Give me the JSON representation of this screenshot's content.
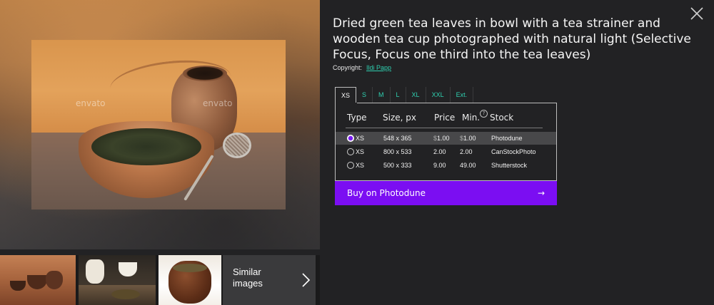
{
  "product": {
    "title": "Dried green tea leaves in bowl with a tea strainer and wooden tea cup photographed with natural light (Selective Focus, Focus one third into the tea leaves)",
    "copyright_label": "Copyright:",
    "copyright_author": "Ildi Papp",
    "watermark": "envato"
  },
  "size_tabs": [
    "XS",
    "S",
    "M",
    "L",
    "XL",
    "XXL",
    "Ext."
  ],
  "active_tab": "XS",
  "table": {
    "headers": {
      "type": "Type",
      "size": "Size, px",
      "price": "Price",
      "min": "Min.",
      "min_help": "?",
      "stock": "Stock"
    },
    "rows": [
      {
        "type": "XS",
        "size": "548 x 365",
        "price_currency": "$",
        "price": "1.00",
        "min_currency": "$",
        "min": "1.00",
        "stock": "Photodune",
        "selected": true
      },
      {
        "type": "XS",
        "size": "800 x 533",
        "price": "2.00",
        "min": "2.00",
        "stock": "CanStockPhoto",
        "selected": false
      },
      {
        "type": "XS",
        "size": "500 x 333",
        "price": "9.00",
        "min": "49.00",
        "stock": "Shutterstock",
        "selected": false
      }
    ]
  },
  "buy_button": {
    "label": "Buy on Photodune",
    "arrow": "→",
    "color": "#7b0ef2"
  },
  "similar": {
    "label": "Similar images"
  },
  "icons": {
    "close": "close-icon",
    "similar_arrow": "chevron-right-icon",
    "min_help": "question-icon"
  },
  "colors": {
    "background": "#222224",
    "accent_link": "#2fd0b0",
    "selected_row": "#48484a"
  }
}
